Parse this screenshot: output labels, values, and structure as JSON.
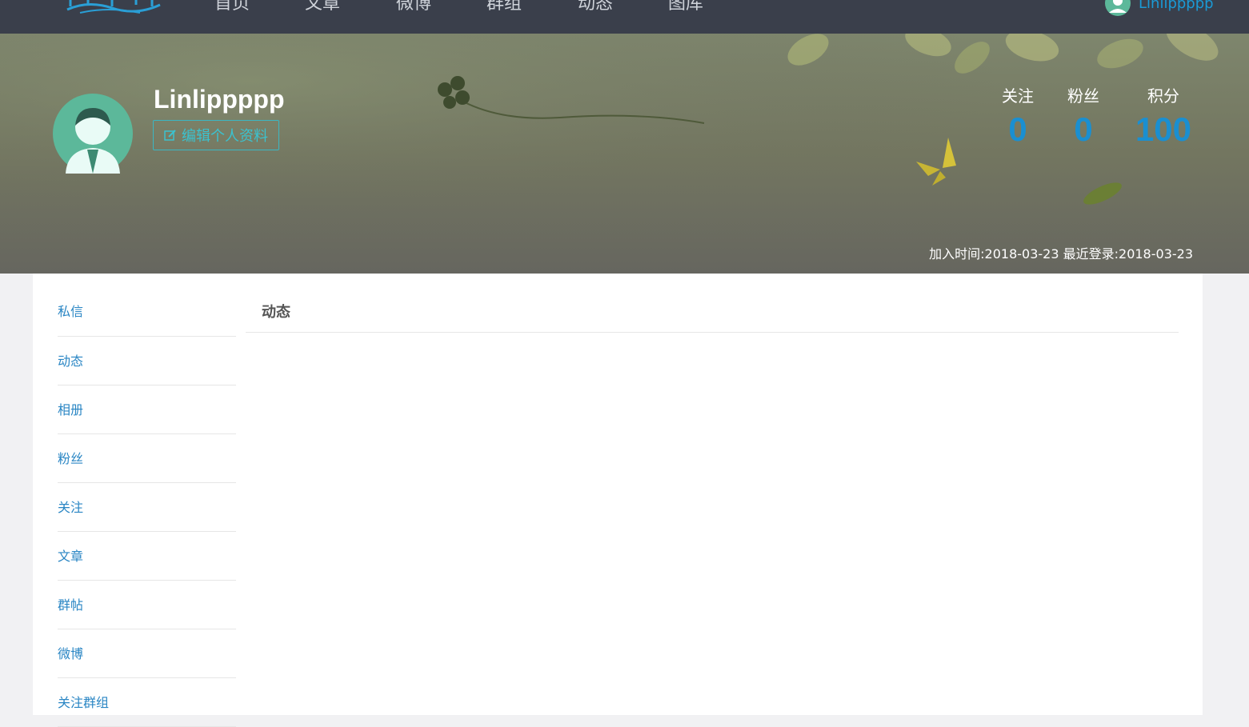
{
  "nav": {
    "items": [
      "首页",
      "文章",
      "微博",
      "群组",
      "动态",
      "图库"
    ],
    "user_name": "Linlippppp"
  },
  "profile": {
    "username": "Linlippppp",
    "edit_button": "编辑个人资料",
    "stats": [
      {
        "label": "关注",
        "value": "0"
      },
      {
        "label": "粉丝",
        "value": "0"
      },
      {
        "label": "积分",
        "value": "100"
      }
    ],
    "join_label": "加入时间:",
    "join_date": "2018-03-23",
    "last_login_label": "最近登录:",
    "last_login_date": "2018-03-23"
  },
  "sidebar": {
    "items": [
      "私信",
      "动态",
      "相册",
      "粉丝",
      "关注",
      "文章",
      "群帖",
      "微博",
      "关注群组"
    ]
  },
  "main": {
    "title": "动态"
  },
  "colors": {
    "nav_bg": "#3a3f4b",
    "accent": "#1a8fd1",
    "button_border": "#3bb7c3",
    "avatar_green": "#5cb89a"
  }
}
